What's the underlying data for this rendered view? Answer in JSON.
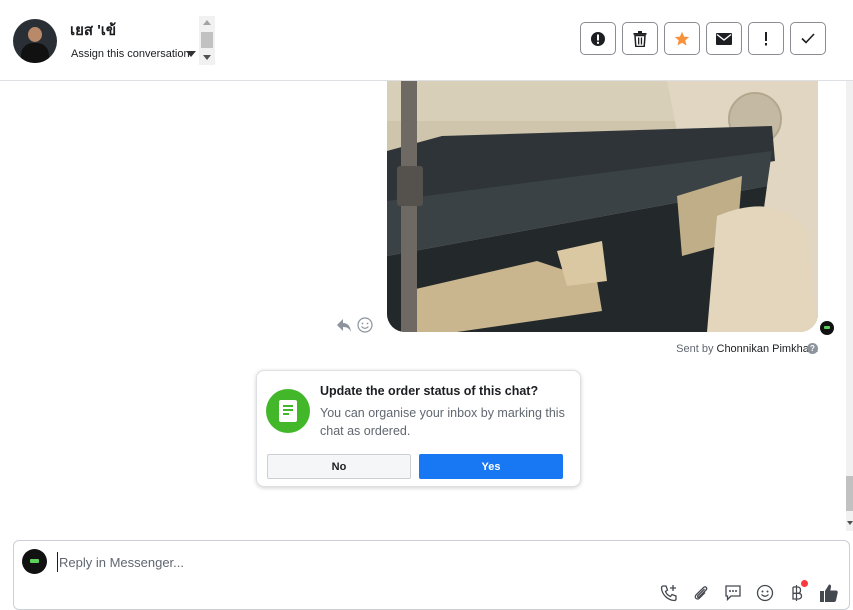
{
  "header": {
    "contact_name": "เยส 'เข้",
    "assign_label": "Assign this conversation",
    "toolbar": [
      {
        "name": "spam",
        "icon": "alert-circle-icon"
      },
      {
        "name": "delete",
        "icon": "trash-icon"
      },
      {
        "name": "star",
        "icon": "star-icon",
        "color": "#f7923b"
      },
      {
        "name": "mark-unread",
        "icon": "envelope-icon"
      },
      {
        "name": "follow-up",
        "icon": "exclamation-icon"
      },
      {
        "name": "done",
        "icon": "check-icon"
      }
    ]
  },
  "thread": {
    "sent_by_prefix": "Sent by ",
    "sent_by_name": "Chonnikan Pimkham",
    "info_mark": "?"
  },
  "order_prompt": {
    "title": "Update the order status of this chat?",
    "text": "You can organise your inbox by marking this chat as ordered.",
    "no_label": "No",
    "yes_label": "Yes"
  },
  "composer": {
    "placeholder": "Reply in Messenger..."
  },
  "colors": {
    "accent": "#1877f2",
    "prompt_green": "#42b72a",
    "star": "#f7923b",
    "notification_dot": "#fa383e"
  }
}
